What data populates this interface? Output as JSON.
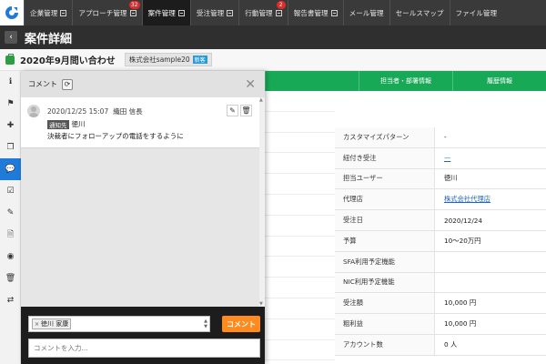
{
  "nav": {
    "tabs": [
      {
        "label": "企業管理"
      },
      {
        "label": "アプローチ管理",
        "badge": "32"
      },
      {
        "label": "案件管理",
        "active": true
      },
      {
        "label": "受注管理"
      },
      {
        "label": "行動管理",
        "badge": "2"
      },
      {
        "label": "報告書管理"
      },
      {
        "label": "メール管理"
      },
      {
        "label": "セールスマップ"
      },
      {
        "label": "ファイル管理"
      }
    ]
  },
  "titlebar": {
    "back_icon": "‹",
    "title": "案件詳細"
  },
  "case": {
    "title": "2020年9月問い合わせ",
    "company": "株式会社sample20",
    "new_tag": "新客"
  },
  "rail": {
    "items": [
      {
        "name": "info-icon",
        "glyph": "ℹ"
      },
      {
        "name": "flag-icon",
        "glyph": "⚑"
      },
      {
        "name": "plus-icon",
        "glyph": "✚"
      },
      {
        "name": "copy-icon",
        "glyph": "❐"
      },
      {
        "name": "chat-icon",
        "glyph": "💬",
        "active": true
      },
      {
        "name": "checkbox-icon",
        "glyph": "☑"
      },
      {
        "name": "clip-icon",
        "glyph": "✎"
      },
      {
        "name": "document-icon",
        "glyph": "🗎"
      },
      {
        "name": "eye-icon",
        "glyph": "◉"
      },
      {
        "name": "trash-icon",
        "glyph": "🗑"
      },
      {
        "name": "swap-icon",
        "glyph": "⇄"
      }
    ]
  },
  "table": {
    "headers": [
      "担当者・部署情報",
      "履歴情報"
    ],
    "rows": [
      {
        "key": "カスタマイズパターン",
        "value": "-"
      },
      {
        "key": "紐付き受注",
        "value": "—",
        "link": true
      },
      {
        "key": "担当ユーザー",
        "value": "徳川"
      },
      {
        "key": "代理店",
        "value": "株式会社代理店",
        "link": true
      },
      {
        "key": "受注日",
        "value": "2020/12/24"
      },
      {
        "key": "予算",
        "value": "10〜20万円"
      },
      {
        "key": "SFA利用予定機能",
        "value": ""
      },
      {
        "key": "NIC利用予定機能",
        "value": ""
      },
      {
        "key": "受注額",
        "value": "10,000 円"
      },
      {
        "key": "粗利益",
        "value": "10,000 円"
      },
      {
        "key": "アカウント数",
        "value": "0 人"
      }
    ]
  },
  "comments": {
    "title": "コメント",
    "refresh_icon": "⟳",
    "close_icon": "✕",
    "items": [
      {
        "date": "2020/12/25 15:07",
        "author": "織田 信長",
        "to_label": "通知先",
        "to": "徳川",
        "body": "決裁者にフォローアップの電話をするように",
        "edit_icon": "✎",
        "delete_icon": "🗑"
      }
    ],
    "compose": {
      "recipient_chip": "徳川 家康",
      "chip_remove": "×",
      "submit_label": "コメント",
      "message_placeholder": "コメントを入力..."
    }
  }
}
